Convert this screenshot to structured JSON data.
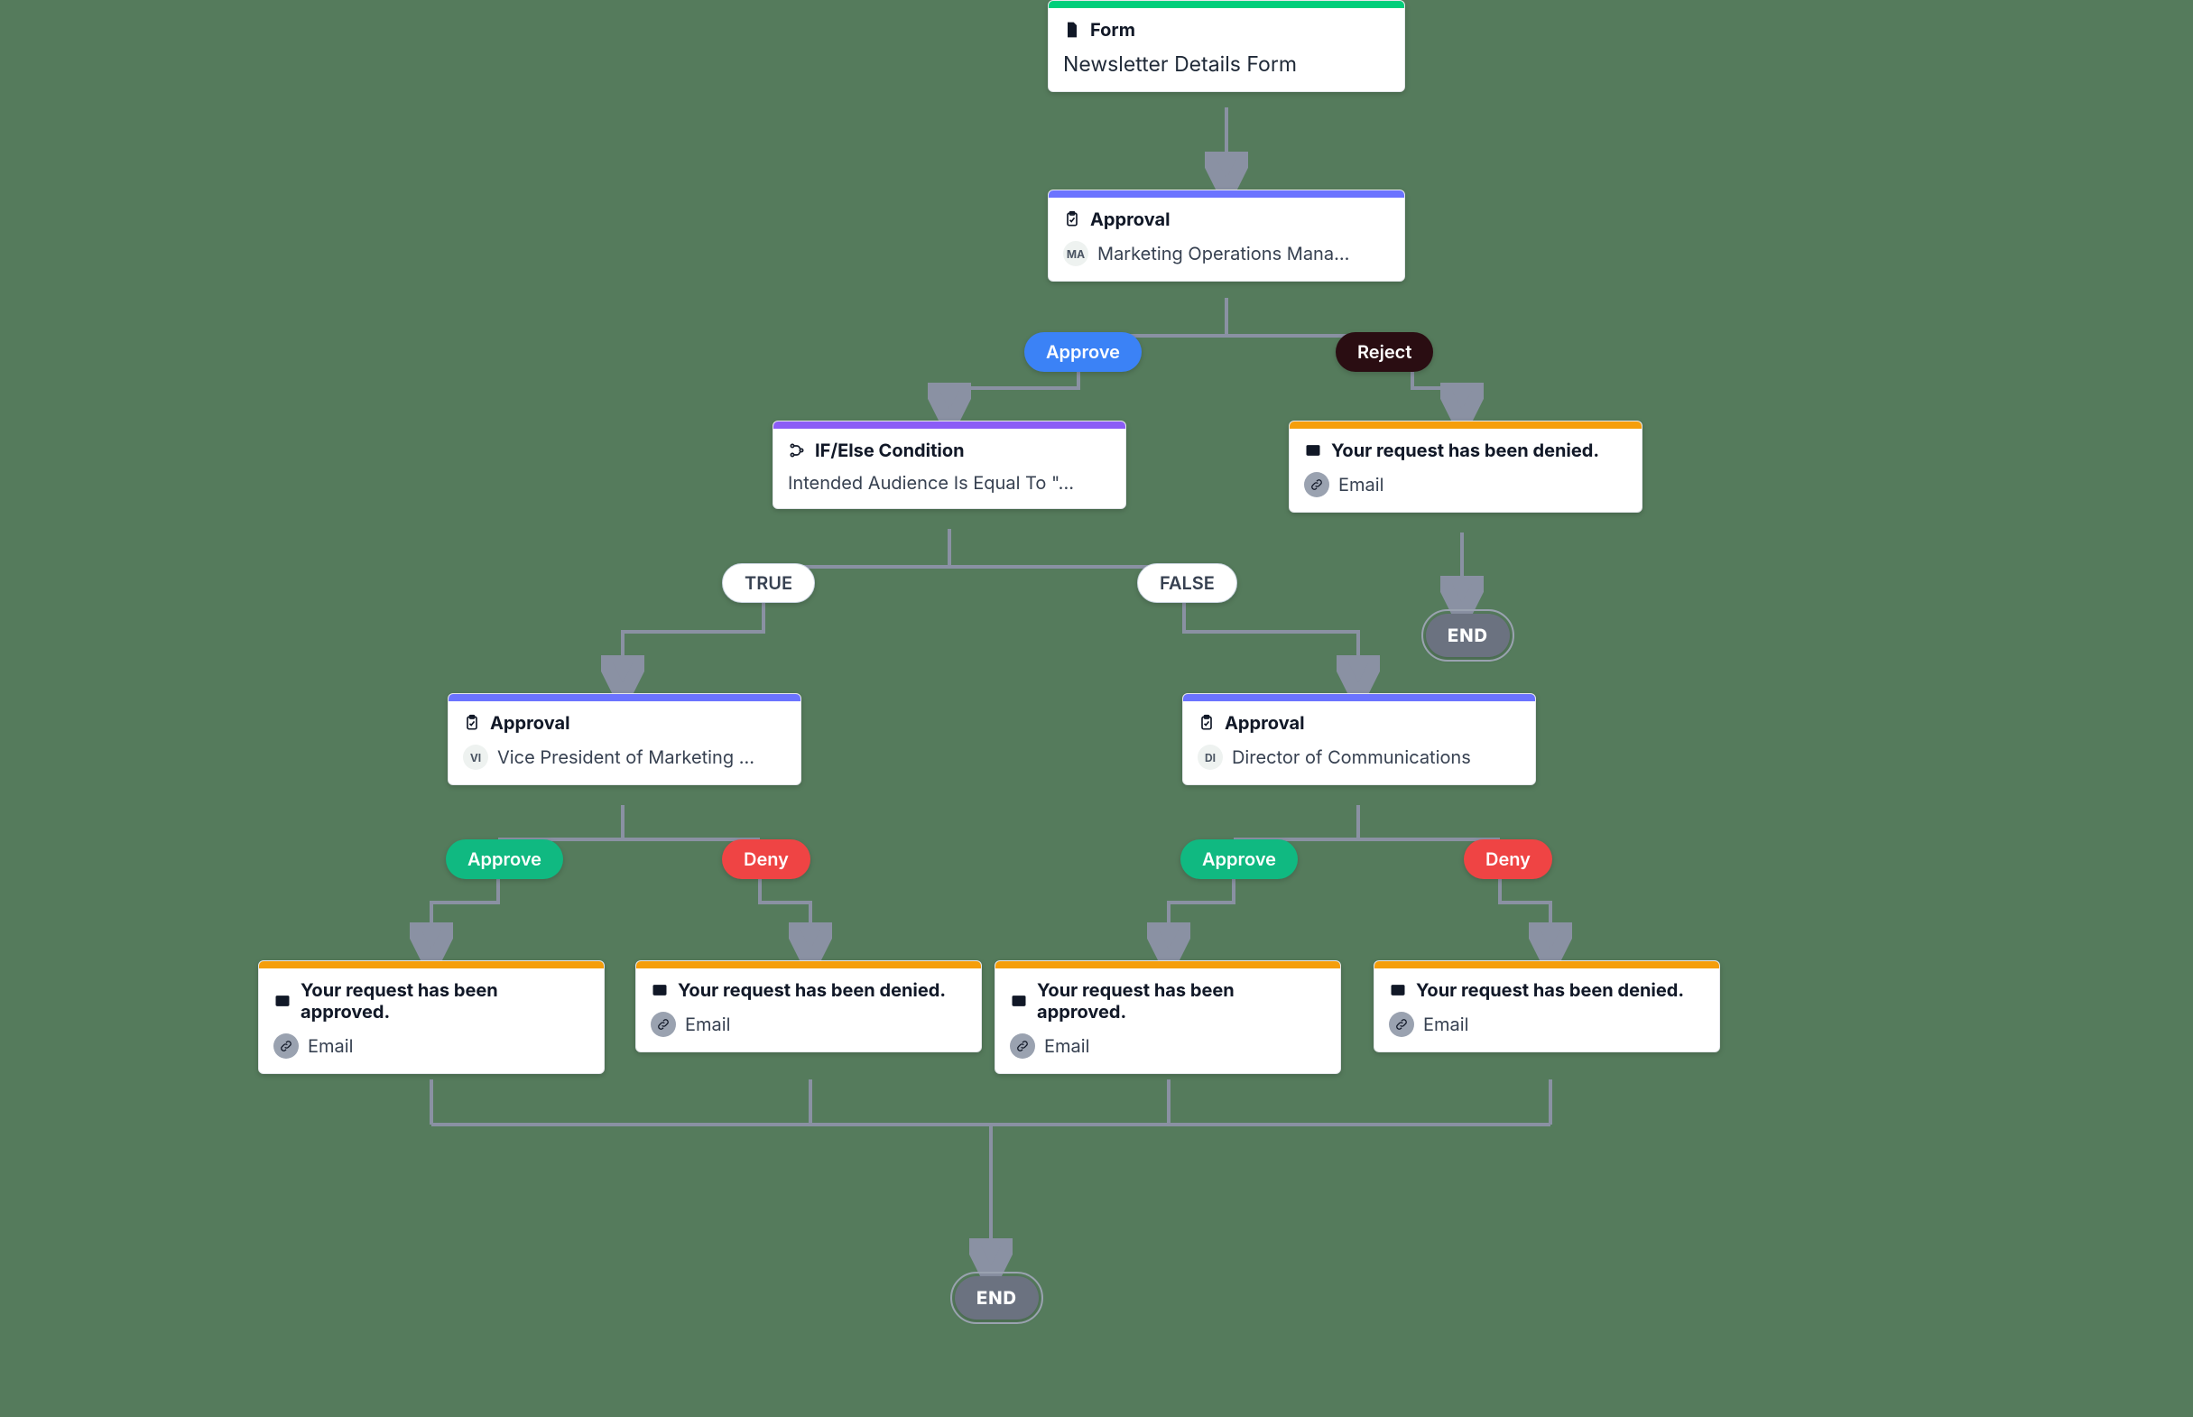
{
  "nodes": {
    "form": {
      "type_label": "Form",
      "title": "Newsletter Details Form"
    },
    "approval_marketing": {
      "type_label": "Approval",
      "avatar": "MA",
      "person": "Marketing Operations Mana..."
    },
    "condition": {
      "type_label": "IF/Else Condition",
      "rule": "Intended Audience Is Equal To \"..."
    },
    "email_denied_top": {
      "type_label": "Your request has been denied.",
      "channel": "Email"
    },
    "approval_vp": {
      "type_label": "Approval",
      "avatar": "VI",
      "person": "Vice President of Marketing ..."
    },
    "approval_dir": {
      "type_label": "Approval",
      "avatar": "DI",
      "person": "Director of Communications"
    },
    "email_approved_left": {
      "type_label": "Your request has been approved.",
      "channel": "Email"
    },
    "email_denied_left": {
      "type_label": "Your request has been denied.",
      "channel": "Email"
    },
    "email_approved_right": {
      "type_label": "Your request has been approved.",
      "channel": "Email"
    },
    "email_denied_right": {
      "type_label": "Your request has been denied.",
      "channel": "Email"
    }
  },
  "pills": {
    "approve_top": "Approve",
    "reject_top": "Reject",
    "true": "TRUE",
    "false": "FALSE",
    "approve_l": "Approve",
    "deny_l": "Deny",
    "approve_r": "Approve",
    "deny_r": "Deny"
  },
  "ends": {
    "top_right": "END",
    "bottom": "END"
  },
  "colors": {
    "bar_form": "#00cf7b",
    "bar_approval": "#6b73ff",
    "bar_condition": "#8b5cf6",
    "bar_email": "#f59e0b"
  }
}
